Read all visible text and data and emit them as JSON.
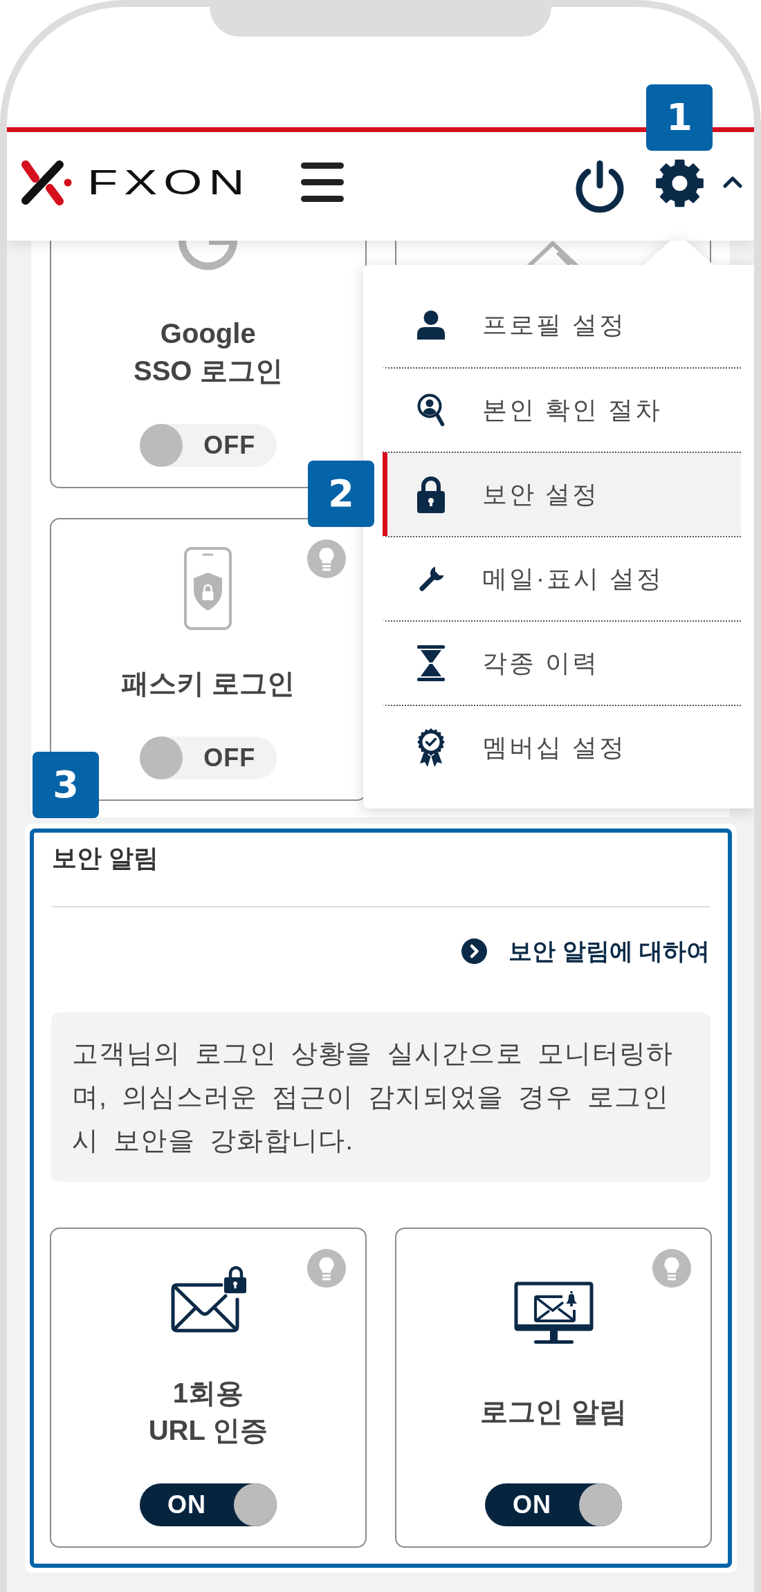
{
  "header": {
    "logo": "FXON",
    "settings_expanded": true,
    "callout": "1"
  },
  "settings_menu": {
    "callout": "2",
    "items": [
      {
        "label": "프로필 설정",
        "selected": false
      },
      {
        "label": "본인 확인 절차",
        "selected": false
      },
      {
        "label": "보안 설정",
        "selected": true
      },
      {
        "label": "메일·표시 설정",
        "selected": false
      },
      {
        "label": "각종 이력",
        "selected": false
      },
      {
        "label": "멤버십 설정",
        "selected": false
      }
    ]
  },
  "login_methods": {
    "cards": [
      {
        "title": "Google\nSSO 로그인",
        "toggle": {
          "label": "OFF",
          "on": false
        }
      },
      {
        "title": "패스키 로그인",
        "toggle": {
          "label": "OFF",
          "on": false
        }
      }
    ]
  },
  "security_alerts": {
    "callout": "3",
    "title": "보안 알림",
    "link": "보안 알림에 대하여",
    "description": "고객님의 로그인 상황을 실시간으로 모니터링하며, 의심스러운 접근이 감지되었을 경우 로그인 시 보안을 강화합니다.",
    "cards": [
      {
        "title": "1회용\nURL 인증",
        "toggle": {
          "label": "ON",
          "on": true
        }
      },
      {
        "title": "로그인 알림",
        "toggle": {
          "label": "ON",
          "on": true
        }
      }
    ]
  }
}
